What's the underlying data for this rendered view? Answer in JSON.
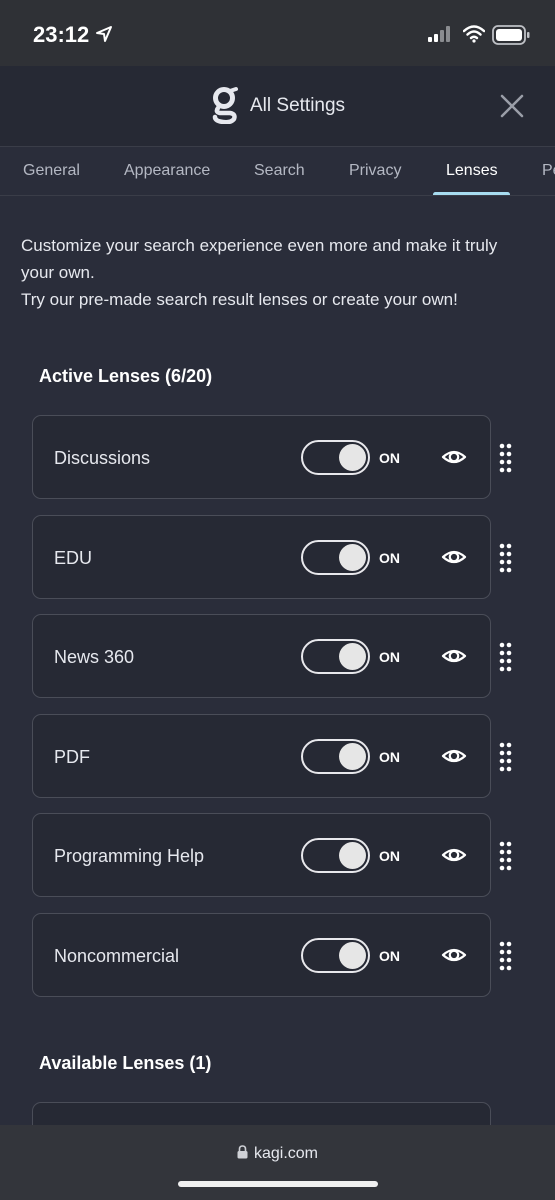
{
  "status_bar": {
    "time": "23:12"
  },
  "header": {
    "title": "All Settings"
  },
  "tabs": [
    {
      "label": "General"
    },
    {
      "label": "Appearance"
    },
    {
      "label": "Search"
    },
    {
      "label": "Privacy"
    },
    {
      "label": "Lenses"
    },
    {
      "label": "Pe"
    }
  ],
  "active_tab": "Lenses",
  "intro": {
    "line1": "Customize your search experience even more and make it truly your own.",
    "line2": "Try our pre-made search result lenses or create your own!"
  },
  "active_lenses": {
    "title": "Active Lenses (6/20)",
    "items": [
      {
        "name": "Discussions",
        "state": "ON"
      },
      {
        "name": "EDU",
        "state": "ON"
      },
      {
        "name": "News 360",
        "state": "ON"
      },
      {
        "name": "PDF",
        "state": "ON"
      },
      {
        "name": "Programming Help",
        "state": "ON"
      },
      {
        "name": "Noncommercial",
        "state": "ON"
      }
    ]
  },
  "available_lenses": {
    "title": "Available Lenses (1)"
  },
  "browser": {
    "url": "kagi.com"
  },
  "colors": {
    "accent": "#a7dcf0",
    "background": "#2a2d3a",
    "card": "#262934"
  }
}
